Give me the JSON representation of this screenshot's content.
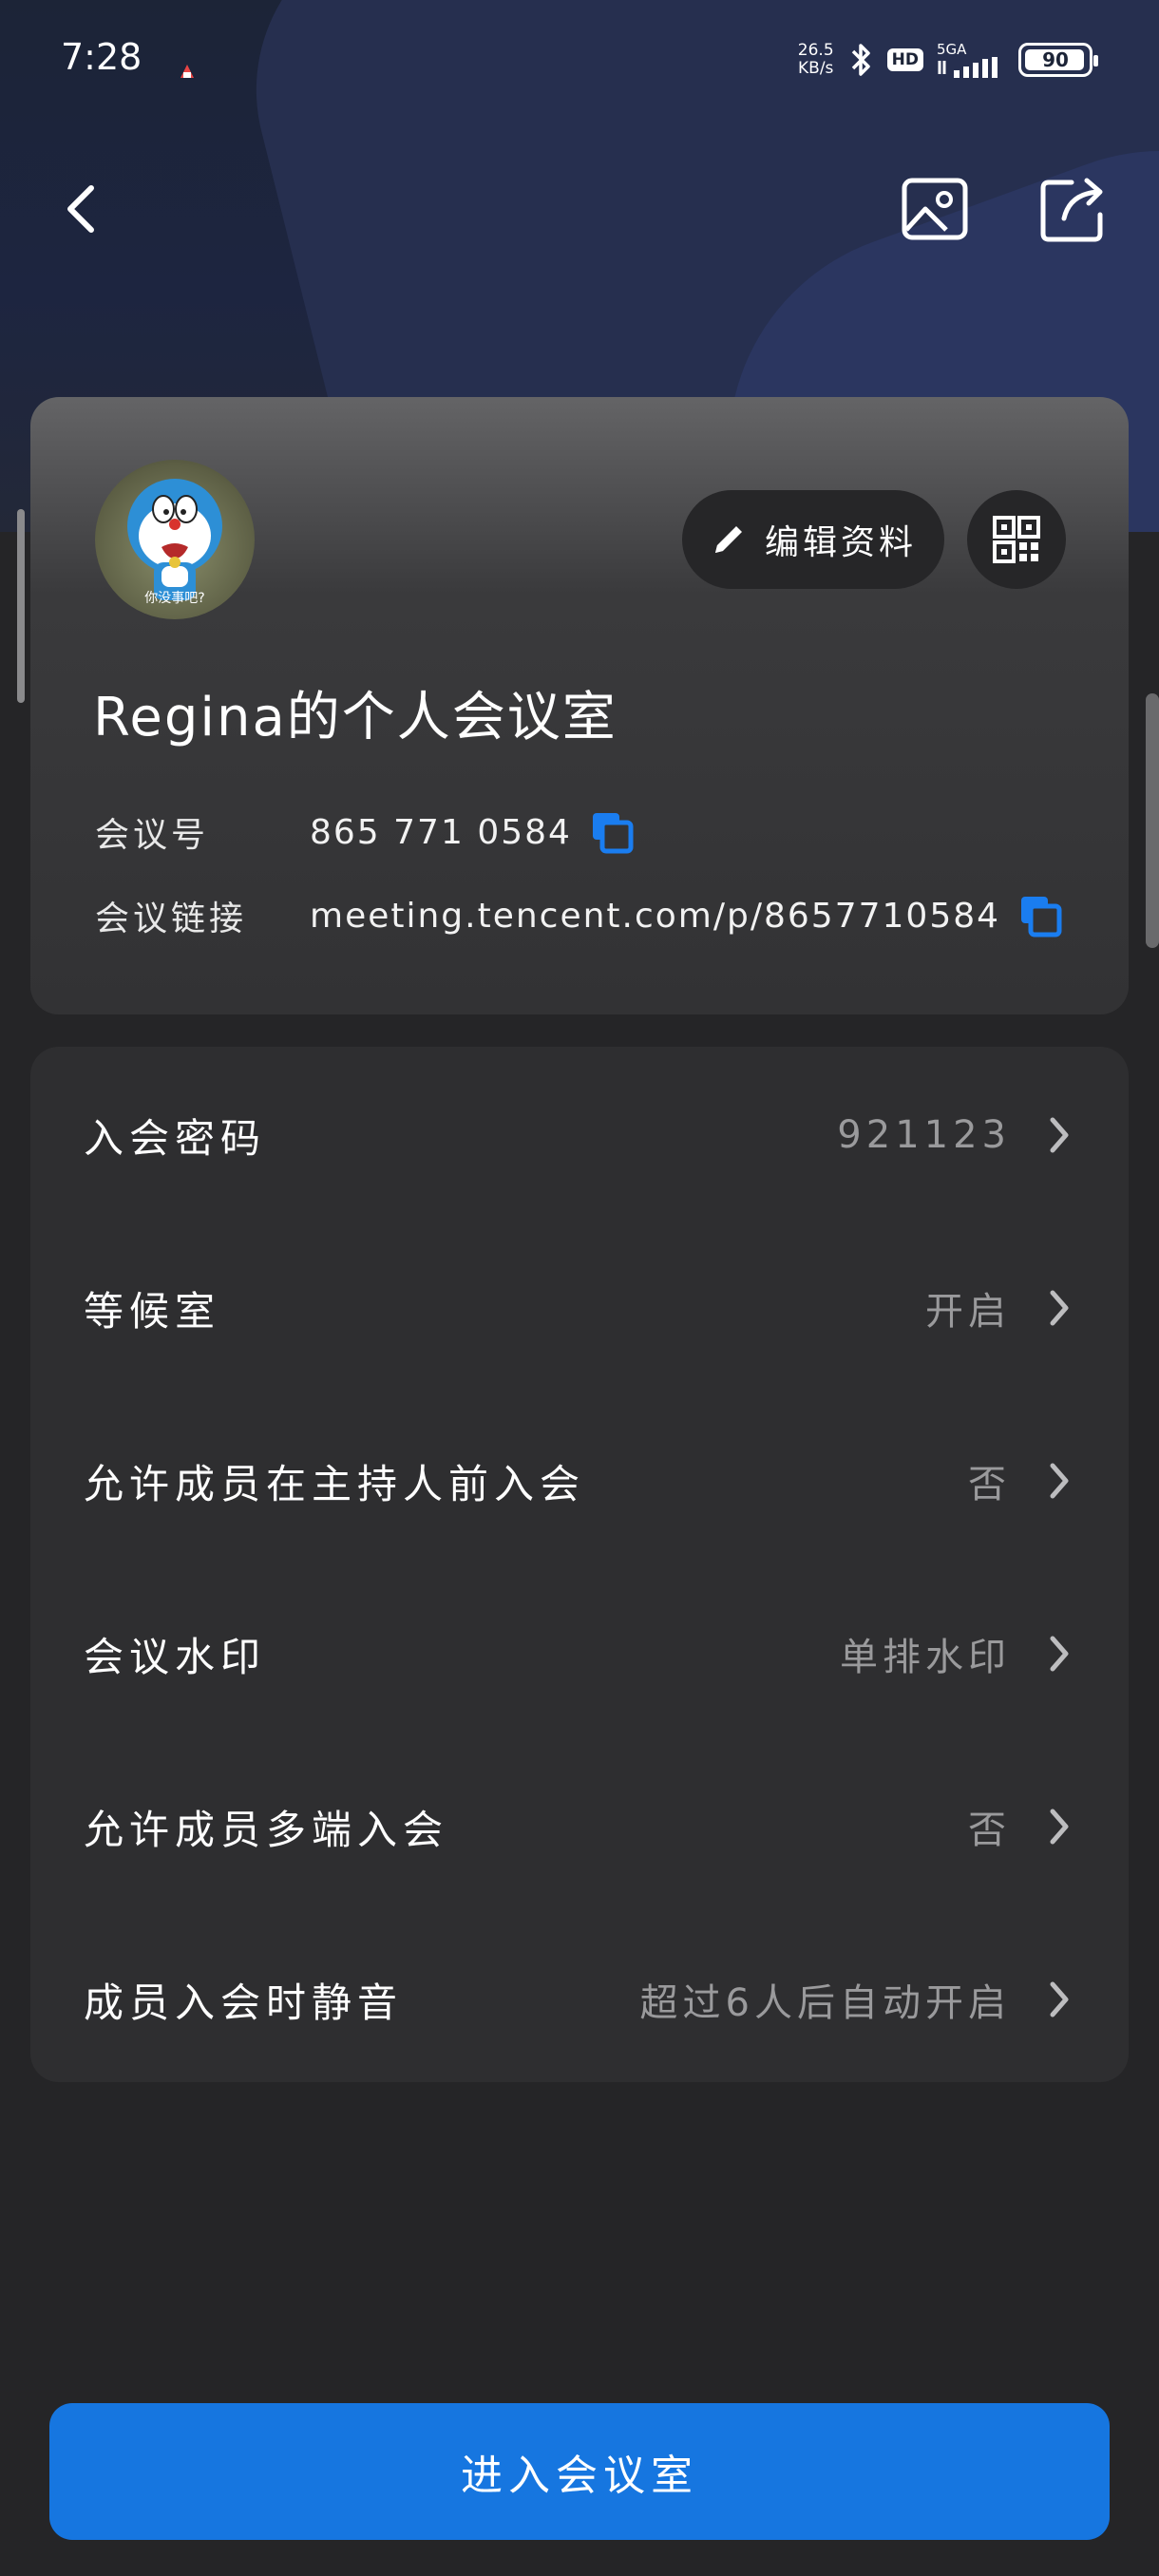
{
  "status_bar": {
    "time": "7:28",
    "net_speed_value": "26.5",
    "net_speed_unit": "KB/s",
    "hd_label": "HD",
    "network_label": "5GA",
    "battery": "90"
  },
  "nav": {
    "back_icon": "chevron-left-icon",
    "image_icon": "image-icon",
    "share_icon": "share-icon"
  },
  "profile": {
    "avatar_caption": "你没事吧?",
    "edit_label": "编辑资料",
    "room_title": "Regina的个人会议室",
    "meeting_id_label": "会议号",
    "meeting_id": "865 771 0584",
    "meeting_link_label": "会议链接",
    "meeting_link": "meeting.tencent.com/p/8657710584"
  },
  "settings": [
    {
      "label": "入会密码",
      "value": "921123"
    },
    {
      "label": "等候室",
      "value": "开启"
    },
    {
      "label": "允许成员在主持人前入会",
      "value": "否"
    },
    {
      "label": "会议水印",
      "value": "单排水印"
    },
    {
      "label": "允许成员多端入会",
      "value": "否"
    },
    {
      "label": "成员入会时静音",
      "value": "超过6人后自动开启"
    }
  ],
  "enter_button": "进入会议室",
  "colors": {
    "accent": "#1676e0",
    "copy_icon": "#1a7df0",
    "background": "#252527",
    "card": "#2e2e30"
  }
}
